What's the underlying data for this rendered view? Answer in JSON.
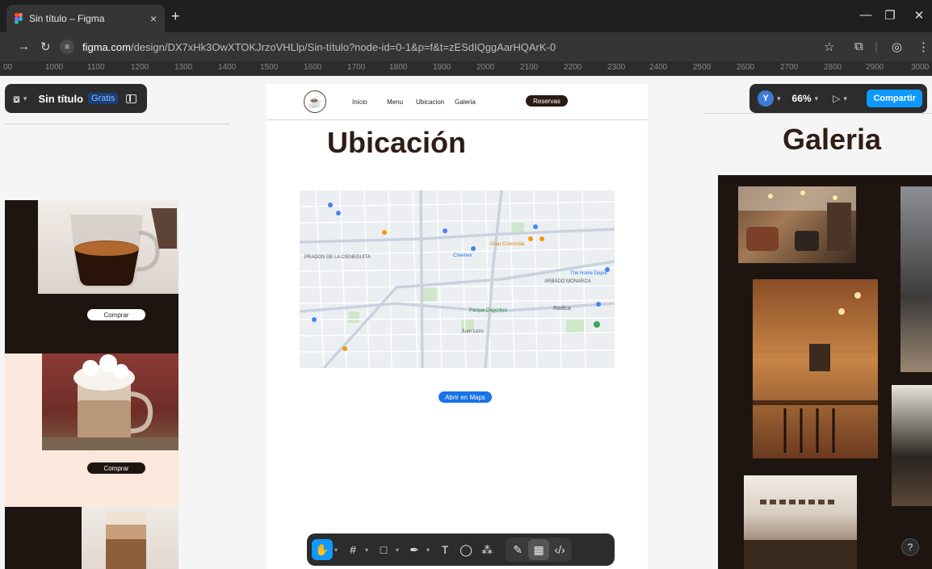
{
  "browser": {
    "tab_title": "Sin título – Figma",
    "tab_close": "×",
    "new_tab": "+",
    "url_host": "figma.com",
    "url_path": "/design/DX7xHk3OwXTOKJrzoVHLlp/Sin-título?node-id=0-1&p=f&t=zESdIQggAarHQArK-0",
    "window_min": "—",
    "window_restore": "❐",
    "window_close": "✕"
  },
  "ruler": {
    "ticks": [
      "00",
      "1000",
      "1100",
      "1200",
      "1300",
      "1400",
      "1500",
      "1600",
      "1700",
      "1800",
      "1900",
      "2000",
      "2100",
      "2200",
      "2300",
      "2400",
      "2500",
      "2600",
      "2700",
      "2800",
      "2900",
      "3000"
    ]
  },
  "figma": {
    "file_name": "Sin título",
    "plan": "Gratis",
    "avatar": "Y",
    "zoom": "66%",
    "share": "Compartir"
  },
  "site": {
    "nav": [
      "Inicio",
      "Menu",
      "Ubicacion",
      "Galeria"
    ],
    "reserve": "Reservas",
    "location_title": "Ubicación",
    "maps_button": "Abrir en Maps",
    "gallery_title": "Galeria",
    "buy": "Comprar"
  },
  "map_labels": {
    "prados": "PRADOS DE LA CIENEGUITA",
    "arbado": "ARBADO MONARCA",
    "radica": "Radica",
    "juan": "Juan Lezo",
    "concordia": "Gran Concordia",
    "depot": "The Home Depot",
    "cinemex": "Cinemex",
    "parque": "Parque Deportivo"
  },
  "help": "?"
}
